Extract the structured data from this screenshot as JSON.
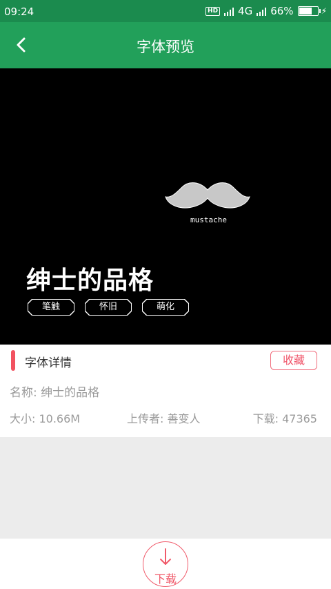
{
  "status_bar": {
    "time": "09:24",
    "hd": "HD",
    "network": "4G",
    "battery_percent": "66%",
    "battery_level": 0.66
  },
  "toolbar": {
    "title": "字体预览"
  },
  "preview": {
    "mustache_text": "mustache",
    "font_name": "绅士的品格",
    "tags": [
      "笔触",
      "怀旧",
      "萌化"
    ]
  },
  "details": {
    "section_title": "字体详情",
    "favorite_label": "收藏",
    "name_line": "名称: 绅士的品格",
    "size_line": "大小: 10.66M",
    "uploader_line": "上传者: 善变人",
    "downloads_line": "下载: 47365"
  },
  "bottom": {
    "download_label": "下载"
  },
  "colors": {
    "status_bar": "#1b8b4e",
    "toolbar": "#22a05a",
    "accent": "#f25260"
  }
}
